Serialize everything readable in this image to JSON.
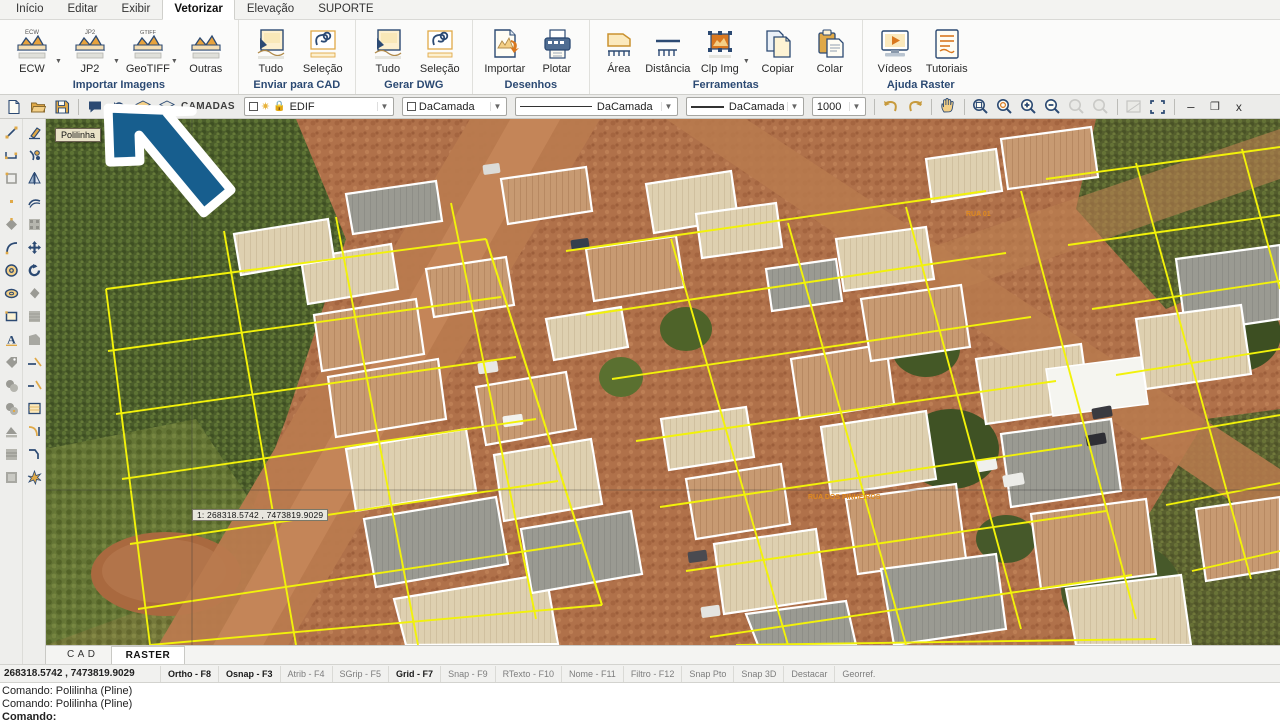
{
  "ribbon": {
    "tabs": [
      {
        "label": "Início",
        "active": false
      },
      {
        "label": "Editar",
        "active": false
      },
      {
        "label": "Exibir",
        "active": false
      },
      {
        "label": "Vetorizar",
        "active": true
      },
      {
        "label": "Elevação",
        "active": false
      },
      {
        "label": "SUPORTE",
        "active": false
      }
    ],
    "groups": [
      {
        "title": "Importar Imagens",
        "buttons": [
          {
            "label": "ECW",
            "icon": "raster-import-icon",
            "badge": "ECW",
            "split": true
          },
          {
            "label": "JP2",
            "icon": "raster-import-icon",
            "badge": "JP2",
            "split": true
          },
          {
            "label": "GeoTIFF",
            "icon": "raster-import-icon",
            "badge": "GTIFF",
            "split": true
          },
          {
            "label": "Outras",
            "icon": "raster-import-icon",
            "badge": "",
            "split": false
          }
        ]
      },
      {
        "title": "Enviar para CAD",
        "buttons": [
          {
            "label": "Tudo",
            "icon": "send-all-icon",
            "badge": "",
            "split": false
          },
          {
            "label": "Seleção",
            "icon": "send-selection-icon",
            "badge": "",
            "split": false
          }
        ]
      },
      {
        "title": "Gerar DWG",
        "buttons": [
          {
            "label": "Tudo",
            "icon": "dwg-all-icon",
            "badge": "",
            "split": false
          },
          {
            "label": "Seleção",
            "icon": "dwg-selection-icon",
            "badge": "",
            "split": false
          }
        ]
      },
      {
        "title": "Desenhos",
        "buttons": [
          {
            "label": "Importar",
            "icon": "import-drawing-icon",
            "badge": "",
            "split": false
          },
          {
            "label": "Plotar",
            "icon": "printer-icon",
            "badge": "",
            "split": false
          }
        ]
      },
      {
        "title": "Ferramentas",
        "buttons": [
          {
            "label": "Área",
            "icon": "area-measure-icon",
            "badge": "",
            "split": false
          },
          {
            "label": "Distância",
            "icon": "distance-measure-icon",
            "badge": "",
            "split": false
          },
          {
            "label": "Clp Img",
            "icon": "clip-image-icon",
            "badge": "",
            "split": true
          },
          {
            "label": "Copiar",
            "icon": "copy-icon",
            "badge": "",
            "split": false
          },
          {
            "label": "Colar",
            "icon": "paste-icon",
            "badge": "",
            "split": false
          }
        ]
      },
      {
        "title": "Ajuda Raster",
        "buttons": [
          {
            "label": "Vídeos",
            "icon": "video-help-icon",
            "badge": "",
            "split": false
          },
          {
            "label": "Tutoriais",
            "icon": "tutorial-doc-icon",
            "badge": "",
            "split": false
          }
        ]
      }
    ]
  },
  "quickbar": {
    "left_icons": [
      {
        "name": "new-file-icon"
      },
      {
        "name": "open-folder-icon"
      },
      {
        "name": "save-icon"
      },
      {
        "name": "comment-icon"
      },
      {
        "name": "undo-history-icon"
      },
      {
        "name": "layers-stack-icon"
      },
      {
        "name": "layers-manager-icon"
      }
    ],
    "camadas_label": "CAMADAS",
    "layer_combo": {
      "value": "EDIF",
      "placeholder": "EDIF"
    },
    "color_combo": {
      "value": "DaCamada",
      "placeholder": "DaCamada"
    },
    "linetype_combo": {
      "value": "DaCamada",
      "placeholder": "DaCamada"
    },
    "lineweight_combo": {
      "value": "DaCamada",
      "placeholder": "DaCamada"
    },
    "scale_combo": {
      "value": "1000",
      "placeholder": "1000"
    },
    "right_icons": [
      {
        "name": "undo-icon"
      },
      {
        "name": "redo-icon"
      },
      {
        "name": "pan-hand-icon"
      },
      {
        "name": "zoom-window-icon"
      },
      {
        "name": "zoom-extents-icon"
      },
      {
        "name": "zoom-in-icon"
      },
      {
        "name": "zoom-out-icon"
      },
      {
        "name": "zoom-previous-icon"
      },
      {
        "name": "zoom-all-icon"
      },
      {
        "name": "regen-icon"
      },
      {
        "name": "fullscreen-icon"
      }
    ],
    "window_controls": [
      {
        "name": "minimize-icon",
        "glyph": "–"
      },
      {
        "name": "restore-icon",
        "glyph": "❐"
      },
      {
        "name": "close-icon",
        "glyph": "x"
      }
    ]
  },
  "left_palette": {
    "column_a": [
      {
        "name": "line-tool-icon"
      },
      {
        "name": "polyline-tool-icon"
      },
      {
        "name": "rectangle-tool-icon"
      },
      {
        "name": "point-tool-icon"
      },
      {
        "name": "polygon-tool-icon"
      },
      {
        "name": "arc-tool-icon"
      },
      {
        "name": "circle-tool-icon"
      },
      {
        "name": "ellipse-tool-icon"
      },
      {
        "name": "image-frame-tool-icon"
      },
      {
        "name": "text-tool-icon"
      },
      {
        "name": "label-tool-icon"
      },
      {
        "name": "block-copy-tool-icon"
      },
      {
        "name": "block-insert-tool-icon"
      },
      {
        "name": "hatch-edit-tool-icon"
      },
      {
        "name": "hatch-region-tool-icon"
      },
      {
        "name": "hatch-solid-tool-icon"
      }
    ],
    "column_b": [
      {
        "name": "erase-tool-icon"
      },
      {
        "name": "trim-tool-icon"
      },
      {
        "name": "mirror-tool-icon"
      },
      {
        "name": "offset-tool-icon"
      },
      {
        "name": "array-tool-icon"
      },
      {
        "name": "move-tool-icon"
      },
      {
        "name": "rotate-tool-icon"
      },
      {
        "name": "scale-tool-icon"
      },
      {
        "name": "stretch-tool-icon"
      },
      {
        "name": "extend-region-tool-icon"
      },
      {
        "name": "extend-tool-icon"
      },
      {
        "name": "break-tool-icon"
      },
      {
        "name": "hatch-fill-tool-icon"
      },
      {
        "name": "fillet-tool-icon"
      },
      {
        "name": "chamfer-tool-icon"
      },
      {
        "name": "explode-tool-icon"
      }
    ]
  },
  "canvas": {
    "tooltip": "Polilinha",
    "coord_tag": "1: 268318.5742 , 7473819.9029",
    "map_labels": [
      "RUA 01",
      "RUA DOS PINHEIROS"
    ],
    "annotation": {
      "name": "blue-arrow-annotation",
      "color": "#175E8E",
      "outline": "#ffffff"
    }
  },
  "doc_tabs": [
    {
      "label": "C A D",
      "active": false
    },
    {
      "label": "RASTER",
      "active": true
    }
  ],
  "status": {
    "coordinates": "268318.5742 , 7473819.9029",
    "toggles": [
      {
        "label": "Ortho - F8",
        "on": true
      },
      {
        "label": "Osnap - F3",
        "on": true
      },
      {
        "label": "Atrib - F4",
        "on": false
      },
      {
        "label": "SGrip - F5",
        "on": false
      },
      {
        "label": "Grid - F7",
        "on": true
      },
      {
        "label": "Snap - F9",
        "on": false
      },
      {
        "label": "RTexto - F10",
        "on": false
      },
      {
        "label": "Nome - F11",
        "on": false
      },
      {
        "label": "Filtro - F12",
        "on": false
      },
      {
        "label": "Snap Pto",
        "on": false
      },
      {
        "label": "Snap 3D",
        "on": false
      },
      {
        "label": "Destacar",
        "on": false
      },
      {
        "label": "Georref.",
        "on": false
      }
    ]
  },
  "command_lines": [
    {
      "text": "Comando: Polilinha (Pline)",
      "current": false
    },
    {
      "text": "Comando: Polilinha (Pline)",
      "current": false
    },
    {
      "text": "Comando:",
      "current": true
    }
  ],
  "colors": {
    "accent_blue": "#2c4a73",
    "arrow_blue": "#175E8E",
    "parcel_yellow": "#f2f20a",
    "building_white": "#ffffff",
    "ribbon_bg": "#fbfbfa"
  }
}
